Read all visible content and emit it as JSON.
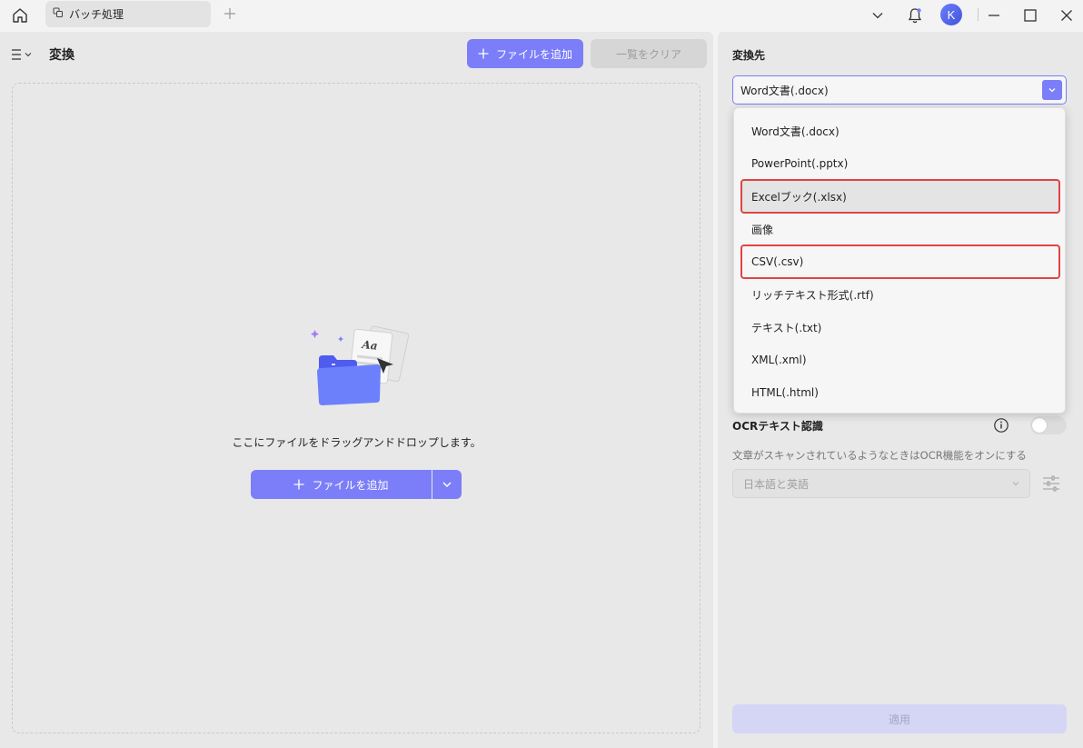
{
  "titlebar": {
    "tab_label": "バッチ処理",
    "avatar_letter": "K"
  },
  "left_panel": {
    "title": "変換",
    "add_file_label": "ファイルを追加",
    "clear_list_label": "一覧をクリア",
    "drop_text": "ここにファイルをドラッグアンドドロップします。",
    "drop_add_label": "ファイルを追加"
  },
  "right_panel": {
    "title": "変換先",
    "selected_format": "Word文書(.docx)",
    "ocr_label": "OCRテキスト認識",
    "ocr_enabled": false,
    "ocr_description": "文章がスキャンされているようなときはOCR機能をオンにする",
    "ocr_language": "日本語と英語",
    "apply_label": "適用"
  },
  "dropdown": {
    "options": [
      {
        "label": "Word文書(.docx)",
        "highlighted": false
      },
      {
        "label": "PowerPoint(.pptx)",
        "highlighted": false
      },
      {
        "label": "Excelブック(.xlsx)",
        "highlighted": true
      },
      {
        "label": "画像",
        "highlighted": false
      },
      {
        "label": "CSV(.csv)",
        "highlighted": true
      },
      {
        "label": "リッチテキスト形式(.rtf)",
        "highlighted": false
      },
      {
        "label": "テキスト(.txt)",
        "highlighted": false
      },
      {
        "label": "XML(.xml)",
        "highlighted": false
      },
      {
        "label": "HTML(.html)",
        "highlighted": false
      }
    ]
  },
  "colors": {
    "accent": "#7b7ef8",
    "highlight_outline": "#e04444"
  }
}
